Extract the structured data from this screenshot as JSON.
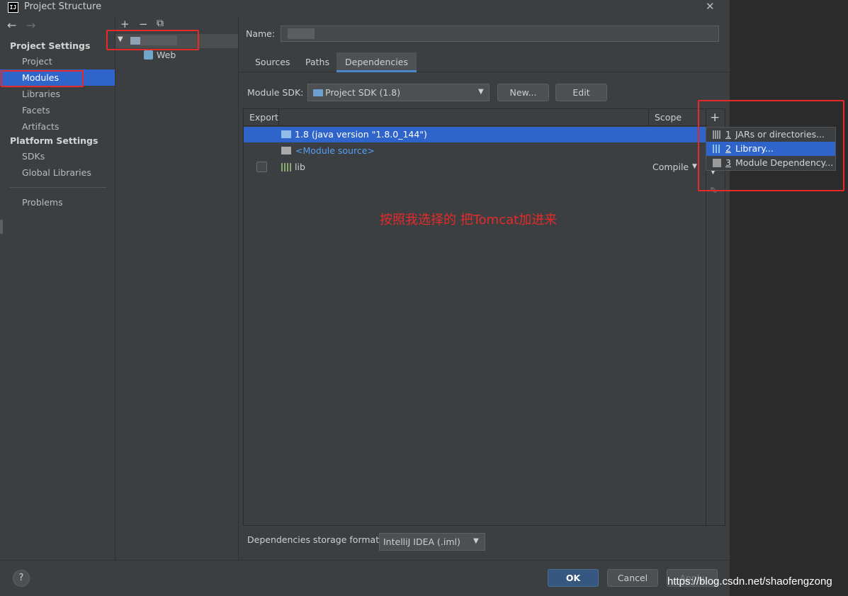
{
  "window": {
    "title": "Project Structure",
    "logo": "IJ",
    "close": "✕"
  },
  "nav": {
    "back": "←",
    "forward": "→",
    "project_settings_header": "Project Settings",
    "project_items": [
      "Project",
      "Modules",
      "Libraries",
      "Facets",
      "Artifacts"
    ],
    "platform_settings_header": "Platform Settings",
    "platform_items": [
      "SDKs",
      "Global Libraries"
    ],
    "problems": "Problems",
    "selected": "Modules"
  },
  "tree": {
    "toolbar": {
      "add": "+",
      "remove": "−",
      "copy": "⧉"
    },
    "child_label": "Web"
  },
  "module": {
    "name_label": "Name:",
    "tabs": [
      "Sources",
      "Paths",
      "Dependencies"
    ],
    "active_tab": "Dependencies",
    "sdk_label": "Module SDK:",
    "sdk_value": "Project SDK (1.8)",
    "new_button": "New...",
    "edit_button": "Edit"
  },
  "dependencies": {
    "header_export": "Export",
    "header_scope": "Scope",
    "rows": [
      {
        "text": "1.8 (java version \"1.8.0_144\")"
      },
      {
        "text": "<Module source>"
      },
      {
        "text": "lib",
        "scope": "Compile"
      }
    ],
    "add_icon": "+",
    "popup": [
      {
        "num": "1",
        "label": "JARs or directories..."
      },
      {
        "num": "2",
        "label": "Library..."
      },
      {
        "num": "3",
        "label": "Module Dependency..."
      }
    ]
  },
  "annotation": "按照我选择的  把Tomcat加进来",
  "storage": {
    "label": "Dependencies storage format:",
    "value": "IntelliJ IDEA (.iml)"
  },
  "footer": {
    "help": "?",
    "ok": "OK",
    "cancel": "Cancel",
    "apply": "Apply"
  },
  "watermark": "https://blog.csdn.net/shaofengzong",
  "colors": {
    "selection": "#2f65ca",
    "annotation_red": "#e62a2a",
    "link_blue": "#589df6"
  }
}
